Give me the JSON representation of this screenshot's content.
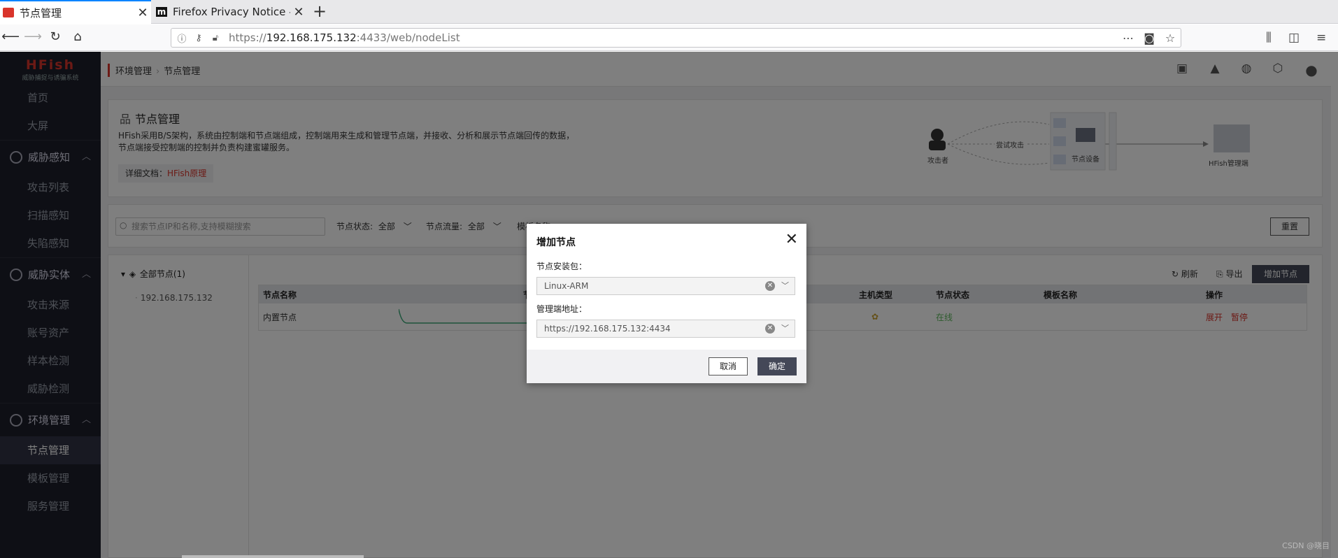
{
  "browser": {
    "tabs": [
      {
        "title": "节点管理",
        "active": true
      },
      {
        "title": "Firefox Privacy Notice — ",
        "active": false
      }
    ],
    "url_prefix": "https://",
    "url_host": "192.168.175.132",
    "url_rest": ":4433/web/nodeList"
  },
  "sidebar": {
    "logo": "HFish",
    "logo_sub": "威胁捕捉与诱骗系统",
    "top_items": [
      "首页",
      "大屏"
    ],
    "groups": [
      {
        "label": "威胁感知",
        "items": [
          "攻击列表",
          "扫描感知",
          "失陷感知"
        ]
      },
      {
        "label": "威胁实体",
        "items": [
          "攻击来源",
          "账号资产",
          "样本检测",
          "威胁检测"
        ]
      },
      {
        "label": "环境管理",
        "items": [
          "节点管理",
          "模板管理",
          "服务管理"
        ]
      }
    ],
    "active_item": "节点管理"
  },
  "header": {
    "crumb_parent": "环境管理",
    "crumb_current": "节点管理"
  },
  "intro": {
    "title": "节点管理",
    "line1": "HFish采用B/S架构，系统由控制端和节点端组成，控制端用来生成和管理节点端，并接收、分析和展示节点端回传的数据，",
    "line2": "节点端接受控制端的控制并负责构建蜜罐服务。",
    "doc_label": "详细文档：",
    "doc_link": "HFish原理",
    "diagram": {
      "attacker": "攻击者",
      "attempt": "尝试攻击",
      "node_device": "节点设备",
      "manager": "HFish管理端"
    }
  },
  "filters": {
    "search_placeholder": "搜索节点IP和名称,支持模糊搜索",
    "status_label": "节点状态:",
    "status_value": "全部",
    "traffic_label": "节点流量:",
    "traffic_value": "全部",
    "template_label": "模板名称:",
    "reset": "重置"
  },
  "tree": {
    "root": "全部节点(1)",
    "leaf": "192.168.175.132"
  },
  "actions": {
    "refresh": "刷新",
    "export": "导出",
    "add": "增加节点"
  },
  "table": {
    "headers": [
      "节点名称",
      "节",
      "主机类型",
      "节点状态",
      "模板名称",
      "操作"
    ],
    "rows": [
      {
        "name": "内置节点",
        "status": "在线",
        "op1": "展开",
        "op2": "暂停"
      }
    ]
  },
  "modal": {
    "title": "增加节点",
    "pkg_label": "节点安装包：",
    "pkg_value": "Linux-ARM",
    "addr_label": "管理端地址：",
    "addr_value": "https://192.168.175.132:4434",
    "cancel": "取消",
    "ok": "确定"
  },
  "watermark": "CSDN @晓目"
}
